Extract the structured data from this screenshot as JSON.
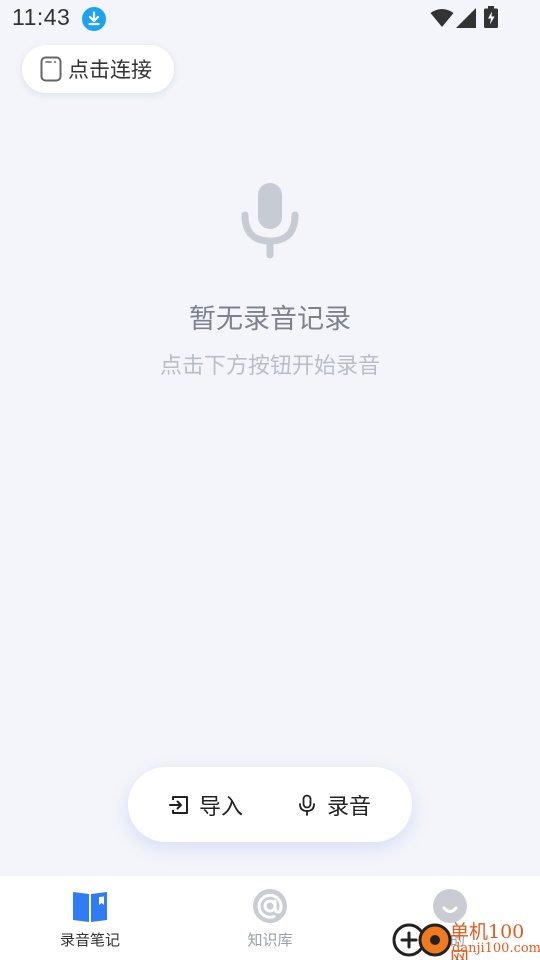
{
  "status_bar": {
    "time": "11:43",
    "icons": [
      "download-icon",
      "wifi-icon",
      "signal-icon",
      "battery-charging-icon"
    ]
  },
  "connect": {
    "label": "点击连接",
    "icon": "device-icon"
  },
  "empty_state": {
    "icon": "microphone-icon",
    "title": "暂无录音记录",
    "subtitle": "点击下方按钮开始录音"
  },
  "actions": {
    "import_label": "导入",
    "import_icon": "import-icon",
    "record_label": "录音",
    "record_icon": "microphone-icon"
  },
  "tabs": [
    {
      "label": "录音笔记",
      "icon": "book-icon",
      "active": true
    },
    {
      "label": "知识库",
      "icon": "at-icon",
      "active": false
    },
    {
      "label": "我的",
      "icon": "profile-icon",
      "active": false
    }
  ],
  "watermark": {
    "text": "单机100网",
    "url": "danji100.com"
  },
  "colors": {
    "background": "#f3f5fa",
    "accent": "#2f7cf6",
    "download_badge": "#1aa3f0",
    "watermark": "#e85a1a"
  }
}
